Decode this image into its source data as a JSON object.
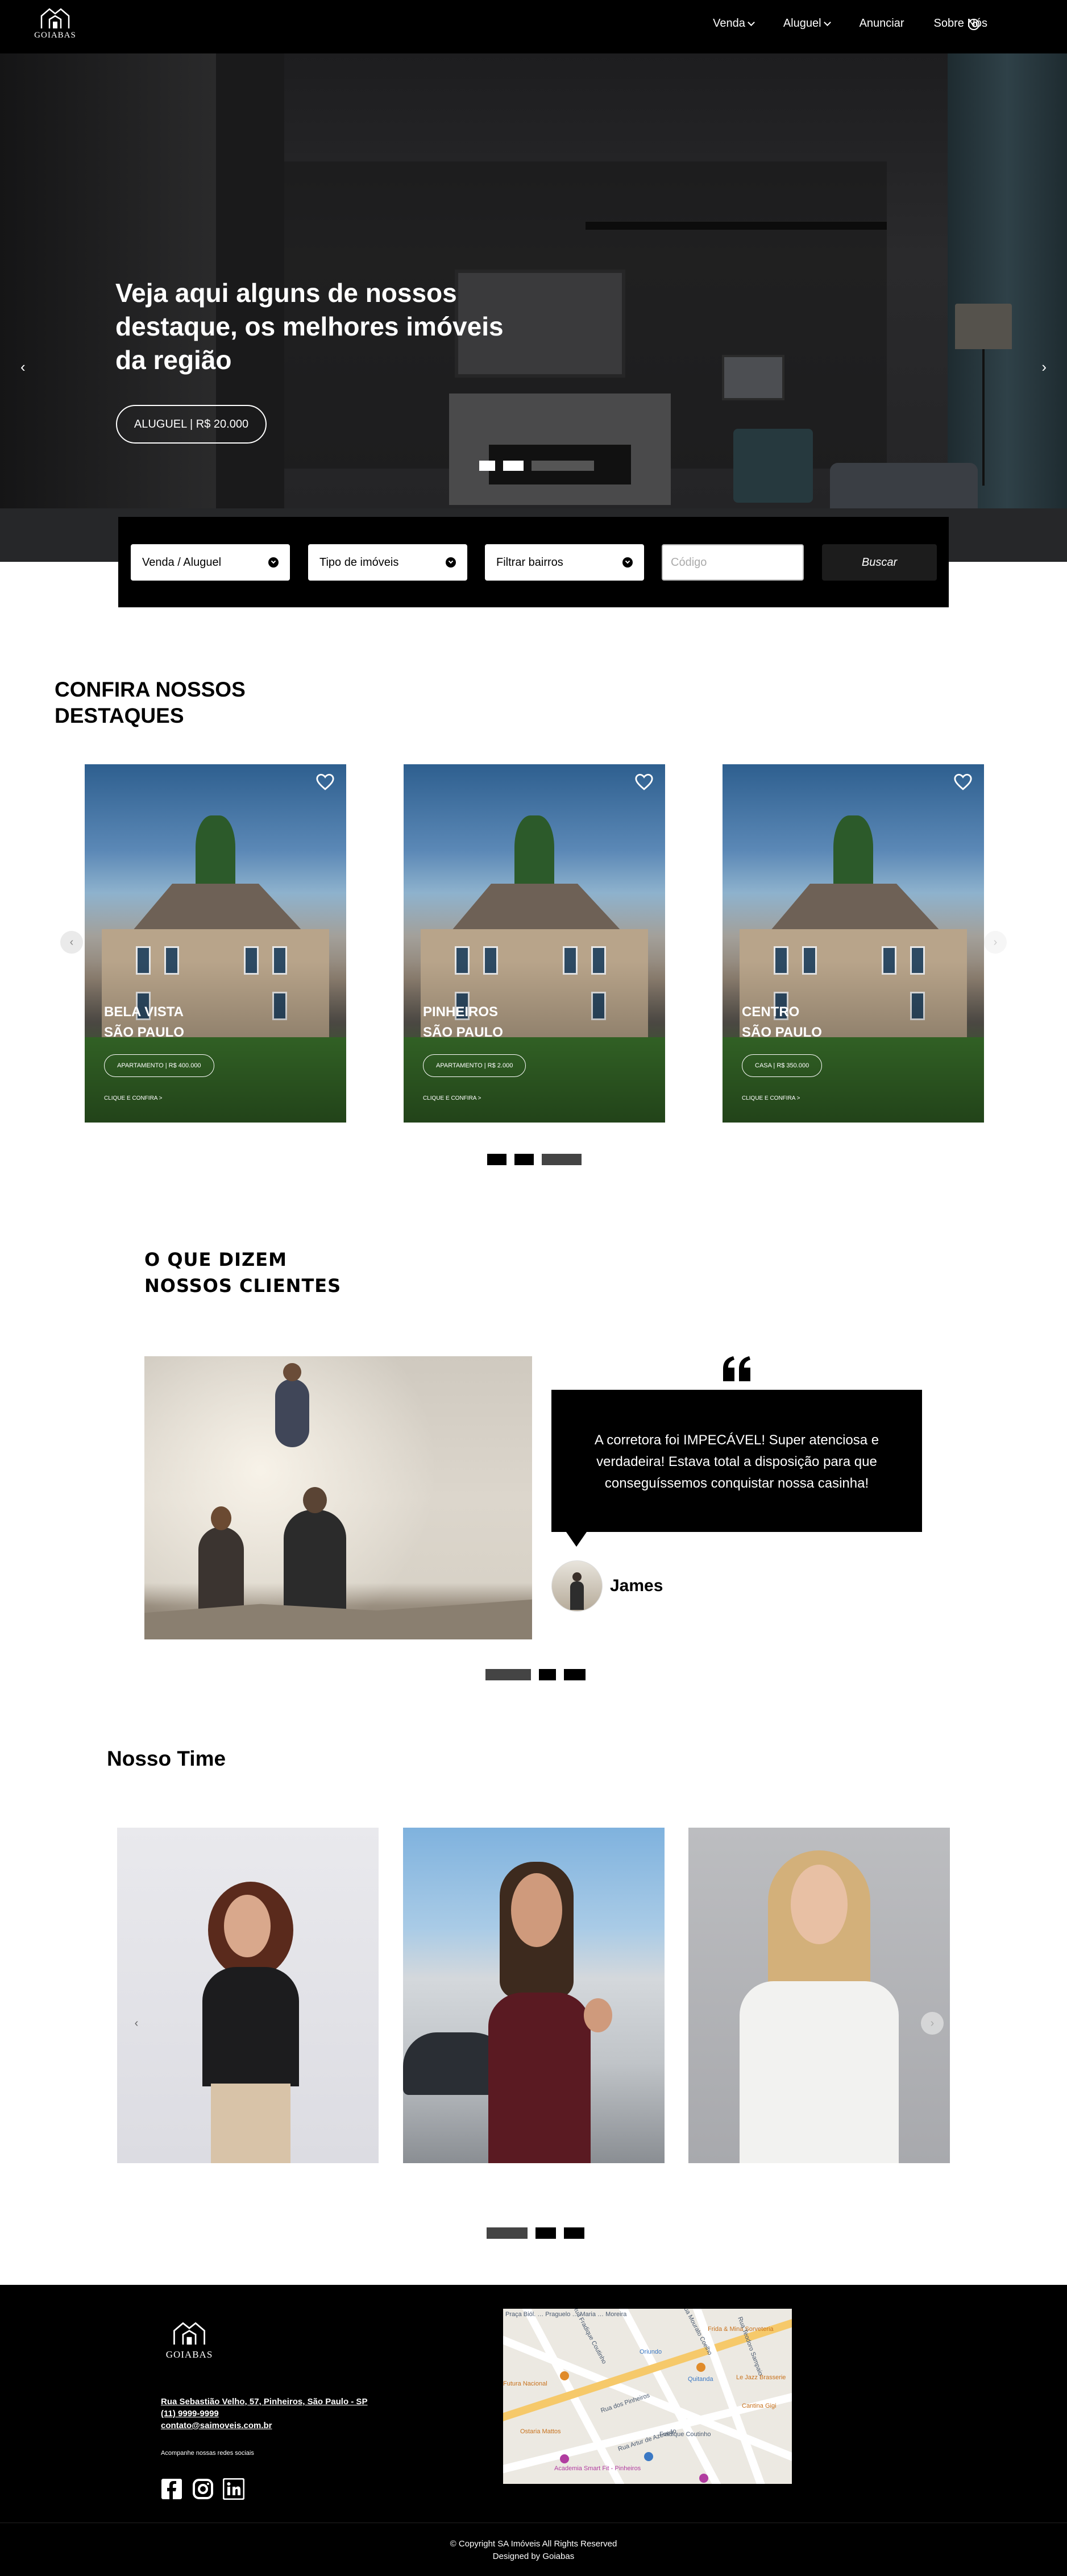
{
  "nav": {
    "logo_text": "GOIABAS",
    "items": [
      {
        "label": "Venda",
        "has_dropdown": true
      },
      {
        "label": "Aluguel",
        "has_dropdown": true
      },
      {
        "label": "Anunciar",
        "has_dropdown": false
      },
      {
        "label": "Sobre Nós",
        "has_dropdown": false
      }
    ],
    "user_icon": "user-circle-icon"
  },
  "hero": {
    "title": "Veja aqui alguns de nossos destaque, os melhores imóveis da região",
    "button_label": "ALUGUEL | R$ 20.000",
    "prev_icon": "chevron-left-icon",
    "next_icon": "chevron-right-icon",
    "slides_count": 3,
    "active_slide": 3
  },
  "search": {
    "type_select": "Venda / Aluguel",
    "property_select": "Tipo de imóveis",
    "district_select": "Filtrar bairros",
    "code_placeholder": "Código",
    "submit_label": "Buscar"
  },
  "highlights": {
    "title_line1": "CONFIRA NOSSOS",
    "title_line2": "DESTAQUES",
    "cards": [
      {
        "district": "BELA VISTA",
        "city": "SÃO PAULO",
        "pill": "APARTAMENTO | R$ 400.000",
        "cta": "CLIQUE E CONFIRA >"
      },
      {
        "district": "PINHEIROS",
        "city": "SÃO PAULO",
        "pill": "APARTAMENTO | R$ 2.000",
        "cta": "CLIQUE E CONFIRA >"
      },
      {
        "district": "CENTRO",
        "city": "SÃO PAULO",
        "pill": "CASA | R$ 350.000",
        "cta": "CLIQUE E CONFIRA >"
      }
    ],
    "active_slide": 3
  },
  "testimonials": {
    "title_line1": "O QUE DIZEM",
    "title_line2": "NOSSOS CLIENTES",
    "quote": "A corretora foi IMPECÁVEL! Super atenciosa e verdadeira! Estava total a disposição para que conseguíssemos conquistar nossa casinha!",
    "author": "James",
    "active_slide": 1
  },
  "team": {
    "title": "Nosso Time",
    "active_slide": 1
  },
  "footer": {
    "logo_text": "GOIABAS",
    "address": "Rua Sebastião Velho, 57, Pinheiros, São Paulo - SP",
    "phone": "(11) 9999-9999",
    "email": "contato@saimoveis.com.br",
    "social_label": "Acompanhe nossas redes sociais",
    "social": [
      "facebook-icon",
      "instagram-icon",
      "linkedin-icon"
    ],
    "copyright_line1": "© Copyright SA Imóveis All Rights Reserved",
    "copyright_line2": "Designed by Goiabas",
    "map_labels": {
      "l1": "Praça Biól. … Praguelo … Maria … Moreira",
      "l2": "Frida & Mina Sorveteria",
      "l3": "Oriundo",
      "l4": "Quitanda",
      "l5": "Le Jazz Brasserie",
      "l6": "Cantina Gigi",
      "l7": "Futura Nacional",
      "l8": "Rua Fradique Coutinho",
      "l9": "Rua dos Pinheiros",
      "l10": "Rua Artur de Azevedo",
      "l11": "Ostaria Mattos",
      "l12": "Fradique Coutinho",
      "l13": "Academia Smart Fit - Pinheiros",
      "l14": "Rua Mourato Coelho",
      "l15": "Rua Teodoro Sampaio"
    }
  }
}
